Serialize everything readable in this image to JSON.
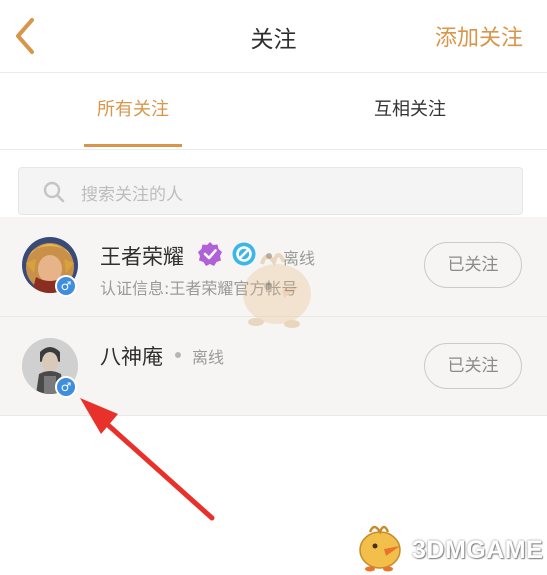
{
  "header": {
    "title": "关注",
    "add_label": "添加关注"
  },
  "tabs": [
    {
      "label": "所有关注",
      "active": true
    },
    {
      "label": "互相关注",
      "active": false
    }
  ],
  "search": {
    "placeholder": "搜索关注的人"
  },
  "follows": [
    {
      "name": "王者荣耀",
      "status": "离线",
      "verify_info": "认证信息:王者荣耀官方帐号",
      "button_label": "已关注",
      "gender": "male",
      "verified": true
    },
    {
      "name": "八神庵",
      "status": "离线",
      "button_label": "已关注",
      "gender": "male",
      "verified": false
    }
  ],
  "watermark": {
    "logo_text": "3DMGAME"
  },
  "colors": {
    "accent": "#d8964a",
    "arrow": "#e8312b",
    "gender_badge": "#3f8ede",
    "verified": "#b061d8"
  }
}
